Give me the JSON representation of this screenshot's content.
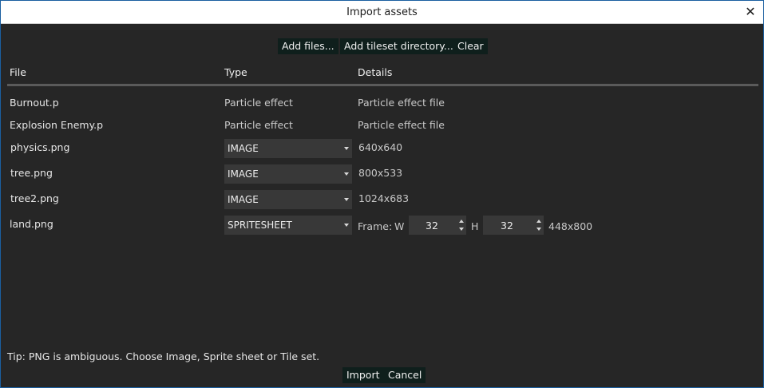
{
  "window": {
    "title": "Import assets"
  },
  "toolbar": {
    "add_files": "Add files...",
    "add_tileset_directory": "Add tileset directory...",
    "clear": "Clear"
  },
  "columns": {
    "file": "File",
    "type": "Type",
    "details": "Details"
  },
  "rows": [
    {
      "file": "Burnout.p",
      "type": "Particle effect",
      "details": "Particle effect file"
    },
    {
      "file": "Explosion Enemy.p",
      "type": "Particle effect",
      "details": "Particle effect file"
    },
    {
      "file": "physics.png",
      "type": "IMAGE",
      "details": "640x640"
    },
    {
      "file": "tree.png",
      "type": "IMAGE",
      "details": "800x533"
    },
    {
      "file": "tree2.png",
      "type": "IMAGE",
      "details": "1024x683"
    },
    {
      "file": "land.png",
      "type": "SPRITESHEET",
      "details": "448x800",
      "frame_label": "Frame:",
      "w_label": "W",
      "w_value": "32",
      "h_label": "H",
      "h_value": "32"
    }
  ],
  "tip": "Tip: PNG is ambiguous. Choose Image, Sprite sheet or Tile set.",
  "footer": {
    "import": "Import",
    "cancel": "Cancel"
  }
}
